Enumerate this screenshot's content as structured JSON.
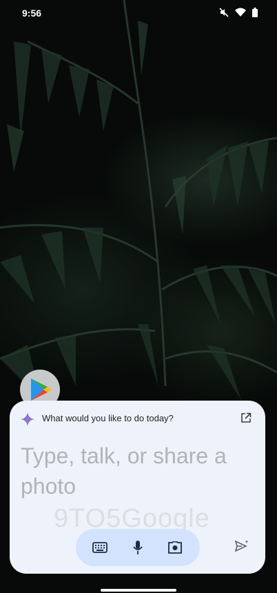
{
  "status_bar": {
    "time": "9:56",
    "icons": [
      "mute-icon",
      "wifi-icon",
      "battery-icon"
    ]
  },
  "home_screen": {
    "app_icons": [
      "play-store-icon"
    ]
  },
  "assistant": {
    "prompt": "What would you like to do today?",
    "input_placeholder": "Type, talk, or share a photo",
    "watermark": "9TO5Google",
    "controls": [
      "keyboard-icon",
      "mic-icon",
      "camera-icon",
      "send-icon",
      "open-in-new-icon",
      "sparkle-icon"
    ],
    "colors": {
      "panel_bg": "#eef3fb",
      "pill_bg": "#d3e3fd",
      "icon": "#1f2a44"
    }
  }
}
